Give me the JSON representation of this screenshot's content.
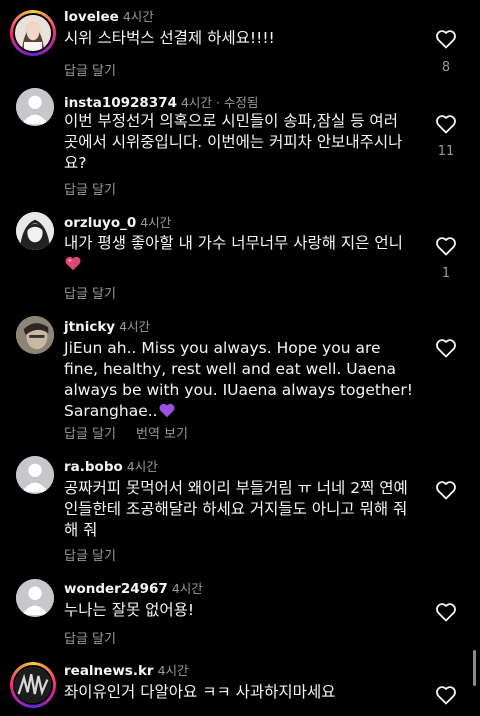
{
  "reply_label": "답글 달기",
  "translate_label": "번역 보기",
  "comments": [
    {
      "user": "lovelee",
      "time": "4시간",
      "edited": "",
      "text": "시위 스타벅스 선결제 하세요!!!!",
      "likes": "8"
    },
    {
      "user": "insta10928374",
      "time": "4시간",
      "edited": "· 수정됨",
      "text": "이번 부정선거 의혹으로 시민들이 송파,잠실 등 여러 곳에서 시위중입니다. 이번에는 커피차 안보내주시나요?",
      "likes": "11"
    },
    {
      "user": "orzluyo_0",
      "time": "4시간",
      "edited": "",
      "text": "내가 평생 좋아할 내 가수 너무너무 사랑해 지은 언니",
      "likes": "1"
    },
    {
      "user": "jtnicky",
      "time": "4시간",
      "edited": "",
      "text": "JiEun ah.. Miss you always. Hope you are fine, healthy, rest well and eat well. Uaena always be with you. IUaena always together! Saranghae..",
      "likes": ""
    },
    {
      "user": "ra.bobo",
      "time": "4시간",
      "edited": "",
      "text": "공짜커피 못먹어서 왜이리 부들거림 ㅠ 너네 2찍 연예인들한테 조공해달라 하세요 거지들도 아니고 뭐해 줘 해 줘",
      "likes": ""
    },
    {
      "user": "wonder24967",
      "time": "4시간",
      "edited": "",
      "text": "누나는 잘못 없어용!",
      "likes": ""
    },
    {
      "user": "realnews.kr",
      "time": "4시간",
      "edited": "",
      "text": "좌이유인거 다알아요 ㅋㅋ 사과하지마세요",
      "likes": ""
    }
  ],
  "colors": {
    "background": "#000000",
    "text": "#f5f5f5",
    "muted": "#9a9a9a",
    "heart_emoji": "#e0457b",
    "purple_heart": "#9b51e0"
  }
}
